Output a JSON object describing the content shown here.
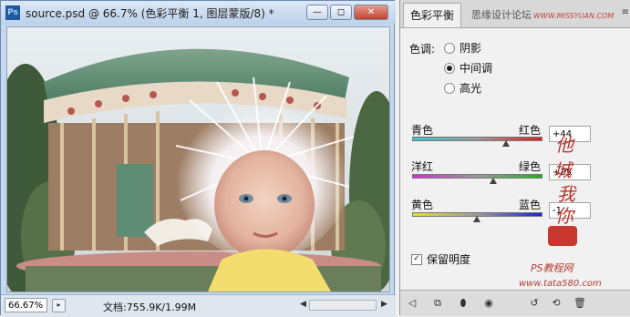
{
  "document": {
    "app_logo_text": "Ps",
    "title": "source.psd @ 66.7% (色彩平衡 1, 图层蒙版/8) *",
    "window_buttons": [
      "minimize",
      "restore",
      "close"
    ],
    "zoom": "66.67%",
    "doc_info": "文档:755.9K/1.99M"
  },
  "panel": {
    "tab_label": "色彩平衡",
    "watermark_text": "思缘设计论坛",
    "watermark_url": "WWW.MISSYUAN.COM",
    "tone_label": "色调:",
    "tones": [
      {
        "label": "阴影",
        "selected": false
      },
      {
        "label": "中间调",
        "selected": true
      },
      {
        "label": "高光",
        "selected": false
      }
    ],
    "sliders": [
      {
        "left_label": "青色",
        "right_label": "红色",
        "value": "+44",
        "level": 44,
        "colors": [
          "#38c8d0",
          "#e02020"
        ]
      },
      {
        "left_label": "洋红",
        "right_label": "绿色",
        "value": "+25",
        "level": 25,
        "colors": [
          "#d030d0",
          "#22b022"
        ]
      },
      {
        "left_label": "黄色",
        "right_label": "蓝色",
        "value": "-1",
        "level": -1,
        "colors": [
          "#e8e020",
          "#2020e0"
        ]
      }
    ],
    "preserve_luminosity_label": "保留明度",
    "preserve_luminosity_checked": true,
    "stamp_text": "他城我你",
    "credit": "PS教程网",
    "credit_url": "www.tata580.com",
    "footer_icons": [
      "back-arrow-icon",
      "clip-layer-icon",
      "layer-mask-icon",
      "visibility-eye-icon",
      "previous-state-icon",
      "reset-icon",
      "delete-icon"
    ]
  }
}
